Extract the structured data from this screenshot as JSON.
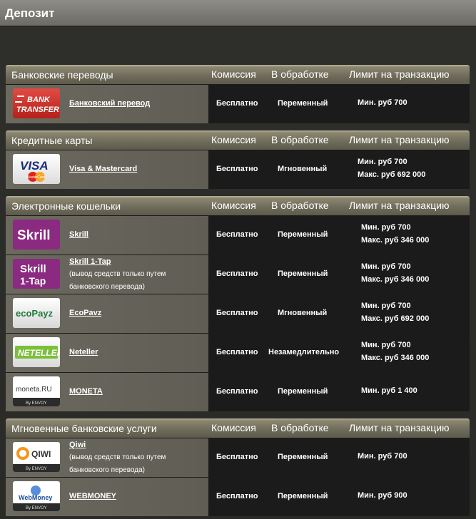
{
  "page_title": "Депозит",
  "columns": {
    "fee": "Комиссия",
    "processing": "В обработке",
    "limit": "Лимит на транзакцию"
  },
  "sections": [
    {
      "title": "Банковские переводы",
      "rows": [
        {
          "name": "Банковский перевод",
          "note": "",
          "fee": "Бесплатно",
          "processing": "Переменный",
          "limit_min": "Мин. руб 700",
          "limit_max": "",
          "logo_text1": "BANK",
          "logo_text2": "TRANSFER"
        }
      ]
    },
    {
      "title": "Кредитные карты",
      "rows": [
        {
          "name": "Visa & Mastercard",
          "note": "",
          "fee": "Бесплатно",
          "processing": "Мгновенный",
          "limit_min": "Мин. руб 700",
          "limit_max": "Макс. руб 692 000",
          "logo_text1": "VISA",
          "logo_text2": "MasterCard"
        }
      ]
    },
    {
      "title": "Электронные кошельки",
      "rows": [
        {
          "name": "Skrill",
          "note": "",
          "fee": "Бесплатно",
          "processing": "Переменный",
          "limit_min": "Мин. руб 700",
          "limit_max": "Макс. руб 346 000",
          "logo_text1": "Skrill",
          "logo_text2": ""
        },
        {
          "name": "Skrill 1-Tap",
          "note_line1": "(вывод средств только путем",
          "note_line2": "банковского перевода)",
          "fee": "Бесплатно",
          "processing": "Переменный",
          "limit_min": "Мин. руб 700",
          "limit_max": "Макс. руб 346 000",
          "logo_text1": "Skrill",
          "logo_text2": "1-Tap"
        },
        {
          "name": "EcoPavz",
          "note": "",
          "fee": "Бесплатно",
          "processing": "Мгновенный",
          "limit_min": "Мин. руб 700",
          "limit_max": "Макс. руб 692 000",
          "logo_text1": "ecoPayz",
          "logo_text2": ""
        },
        {
          "name": "Neteller",
          "note": "",
          "fee": "Бесплатно",
          "processing": "Незамедлительно",
          "limit_min": "Мин. руб 700",
          "limit_max": "Макс. руб 346 000",
          "logo_text1": "NETELLER",
          "logo_text2": ""
        },
        {
          "name": "MONETA",
          "note": "",
          "fee": "Бесплатно",
          "processing": "Переменный",
          "limit_min": "Мин. руб 1 400",
          "limit_max": "",
          "logo_text1": "moneta.RU",
          "logo_text2": "By ENVOY"
        }
      ]
    },
    {
      "title": "Мгновенные банковские услуги",
      "rows": [
        {
          "name": "Qiwi",
          "note_line1": "(вывод средств только путем",
          "note_line2": "банковского перевода)",
          "fee": "Бесплатно",
          "processing": "Переменный",
          "limit_min": "Мин. руб 700",
          "limit_max": "",
          "logo_text1": "QIWI",
          "logo_text2": "By ENVOY"
        },
        {
          "name": "WEBMONEY",
          "note": "",
          "fee": "Бесплатно",
          "processing": "Переменный",
          "limit_min": "Мин. руб 900",
          "limit_max": "",
          "logo_text1": "WebMoney",
          "logo_text2": "By ENVOY"
        }
      ]
    }
  ]
}
